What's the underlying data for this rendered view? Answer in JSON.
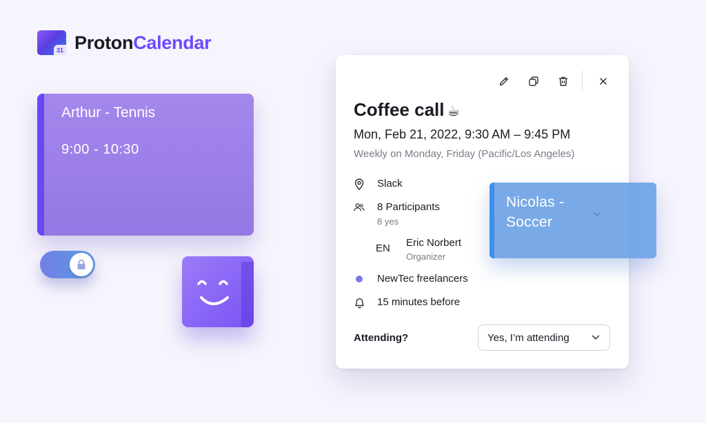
{
  "logo": {
    "brand": "Proton",
    "product": "Calendar",
    "mark_day": "31"
  },
  "events": {
    "arthur": {
      "title": "Arthur - Tennis",
      "time": "9:00 - 10:30",
      "color": "#9478e3"
    },
    "nicolas": {
      "title": "Nicolas - Soccer",
      "color": "#669ee4"
    }
  },
  "toggle": {
    "state": "on",
    "knob_icon": "lock-icon"
  },
  "popover": {
    "actions": [
      {
        "name": "edit-icon"
      },
      {
        "name": "duplicate-icon"
      },
      {
        "name": "delete-icon"
      },
      {
        "name": "close-icon"
      }
    ],
    "title": "Coffee call",
    "title_emoji": "☕",
    "datetime": "Mon, Feb 21, 2022, 9:30 AM – 9:45 PM",
    "recurrence": "Weekly on Monday, Friday (Pacific/Los Angeles)",
    "location": "Slack",
    "participants": {
      "label": "8 Participants",
      "summary": "8 yes"
    },
    "organizer": {
      "initials": "EN",
      "name": "Eric Norbert",
      "role": "Organizer"
    },
    "calendar": {
      "name": "NewTec freelancers",
      "color": "#7b77e8"
    },
    "reminder": "15 minutes before",
    "attending": {
      "label": "Attending?",
      "value": "Yes, I’m attending"
    }
  },
  "colors": {
    "accent": "#6d4aff",
    "background": "#f6f4fc"
  }
}
